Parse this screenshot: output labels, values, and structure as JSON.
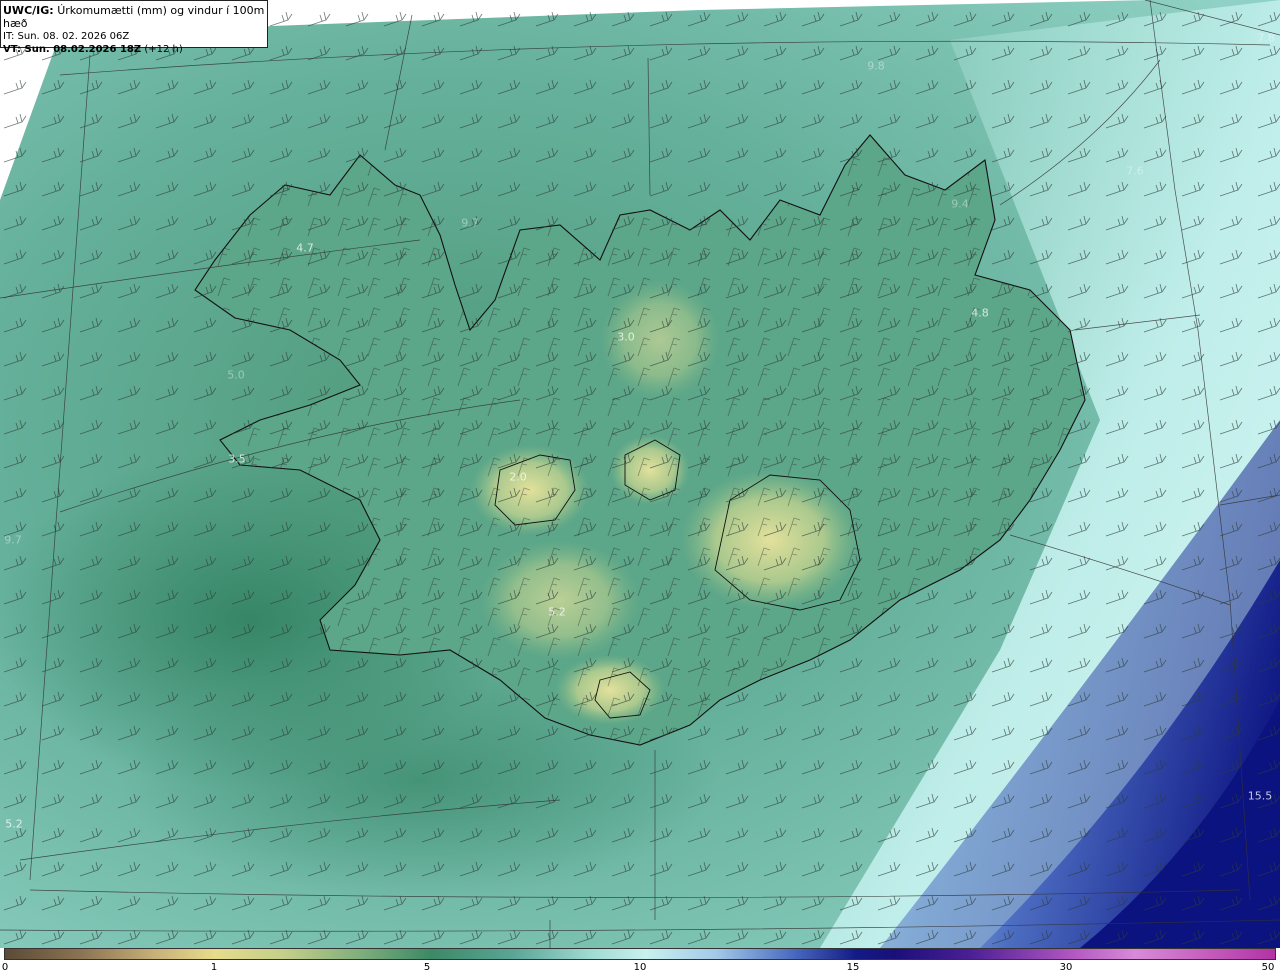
{
  "header": {
    "model": "UWC/IG:",
    "title": "Úrkomumætti (mm) og vindur í 100m hæð",
    "it_line": "IT: Sun. 08. 02. 2026 06Z",
    "vt_prefix": "VT: Sun. 08.02.2026 18Z",
    "vt_suffix": "(+12 h)"
  },
  "colorbar": {
    "ticks": [
      "0",
      "1",
      "5",
      "10",
      "15",
      "30",
      "50"
    ]
  },
  "map_labels": [
    {
      "text": "7.8"
    },
    {
      "text": "9.8"
    },
    {
      "text": "7.6"
    },
    {
      "text": "9.4"
    },
    {
      "text": "9.7"
    },
    {
      "text": "4.7"
    },
    {
      "text": "3.0"
    },
    {
      "text": "4.8"
    },
    {
      "text": "3.5"
    },
    {
      "text": "5.0"
    },
    {
      "text": "2.0"
    },
    {
      "text": "9.7"
    },
    {
      "text": "5.2"
    },
    {
      "text": "15.5"
    },
    {
      "text": "5.2"
    }
  ]
}
